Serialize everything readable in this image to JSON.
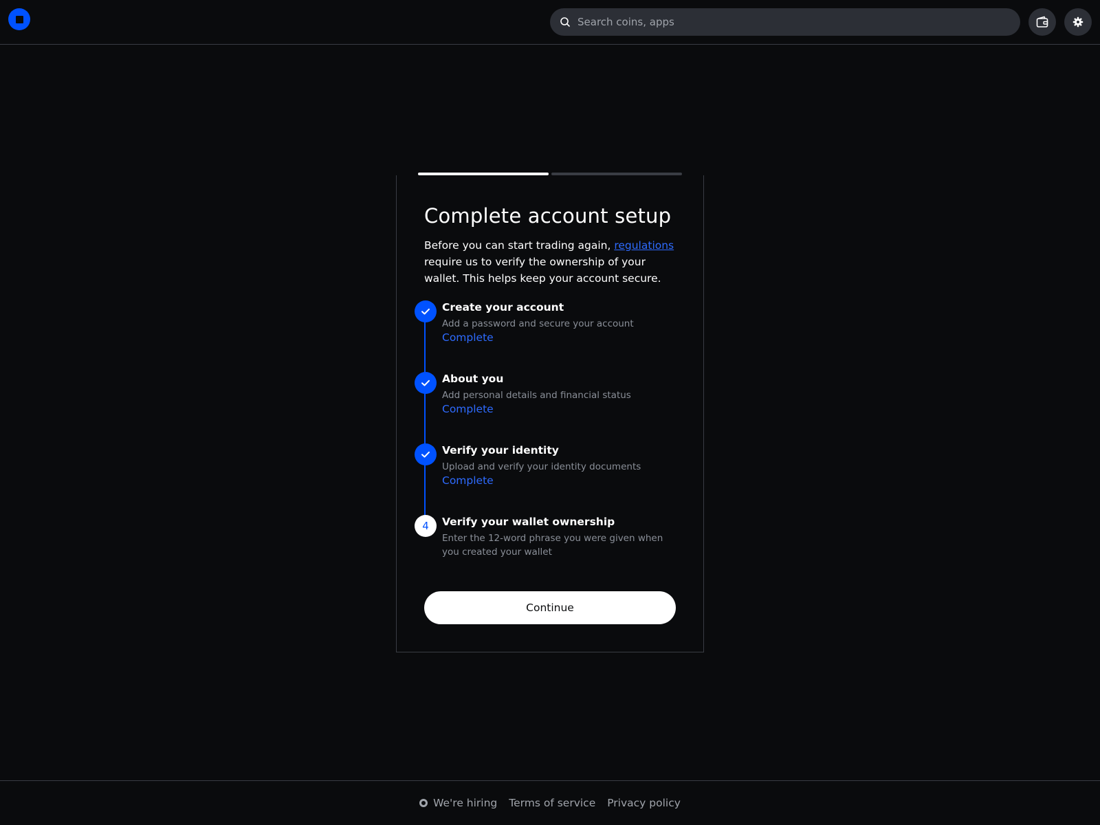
{
  "header": {
    "search_placeholder": "Search coins, apps"
  },
  "setup": {
    "title": "Complete account setup",
    "intro_before": "Before you can start trading again, ",
    "intro_link": "regulations",
    "intro_after": " require us to verify the ownership of your wallet. This helps keep your account secure.",
    "steps": [
      {
        "title": "Create your account",
        "desc": "Add a password and secure your account",
        "status": "Complete"
      },
      {
        "title": "About you",
        "desc": "Add personal details and financial status",
        "status": "Complete"
      },
      {
        "title": "Verify your identity",
        "desc": "Upload and verify your identity documents",
        "status": "Complete"
      },
      {
        "number": "4",
        "title": "Verify your wallet ownership",
        "desc": "Enter the 12-word phrase you were given when you created your wallet"
      }
    ],
    "progress": {
      "current_step": 1,
      "total_steps": 2
    },
    "continue_label": "Continue"
  },
  "footer": {
    "hiring": "We're hiring",
    "terms": "Terms of service",
    "privacy": "Privacy policy"
  },
  "colors": {
    "accent": "#0052ff",
    "background": "#0a0b0d"
  }
}
